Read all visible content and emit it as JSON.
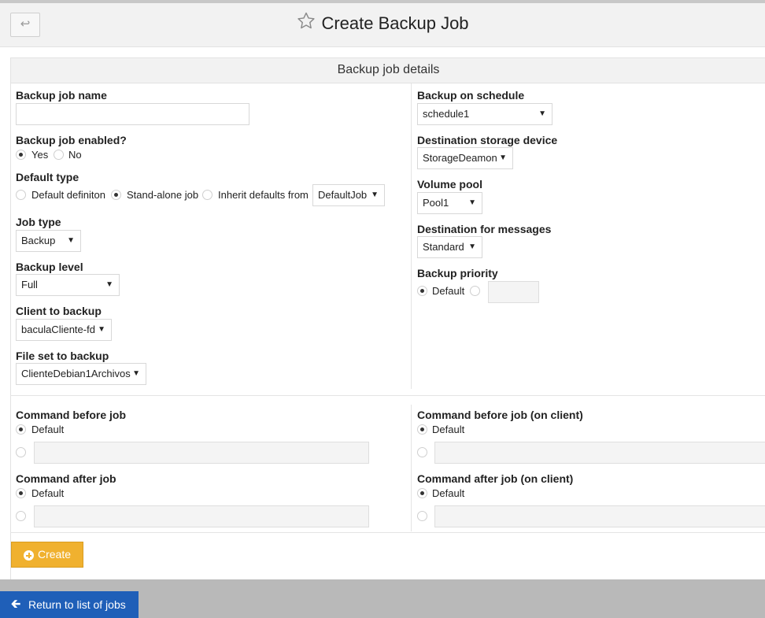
{
  "header": {
    "back_icon": "↩",
    "title": "Create Backup Job"
  },
  "panel": {
    "heading": "Backup job details"
  },
  "left": {
    "job_name": {
      "label": "Backup job name",
      "value": ""
    },
    "enabled": {
      "label": "Backup job enabled?",
      "yes": "Yes",
      "no": "No",
      "selected": "Yes"
    },
    "default_type": {
      "label": "Default type",
      "opt_definition": "Default definiton",
      "opt_standalone": "Stand-alone job",
      "opt_inherit": "Inherit defaults from",
      "inherit_value": "DefaultJob",
      "selected": "Stand-alone job"
    },
    "job_type": {
      "label": "Job type",
      "value": "Backup"
    },
    "backup_level": {
      "label": "Backup level",
      "value": "Full"
    },
    "client": {
      "label": "Client to backup",
      "value": "baculaCliente-fd"
    },
    "fileset": {
      "label": "File set to backup",
      "value": "ClienteDebian1Archivos"
    }
  },
  "right": {
    "schedule": {
      "label": "Backup on schedule",
      "value": "schedule1"
    },
    "storage": {
      "label": "Destination storage device",
      "value": "StorageDeamon"
    },
    "pool": {
      "label": "Volume pool",
      "value": "Pool1"
    },
    "messages": {
      "label": "Destination for messages",
      "value": "Standard"
    },
    "priority": {
      "label": "Backup priority",
      "default": "Default",
      "value": ""
    }
  },
  "commands": {
    "before": {
      "label": "Command before job",
      "default": "Default",
      "value": ""
    },
    "after": {
      "label": "Command after job",
      "default": "Default",
      "value": ""
    },
    "before_client": {
      "label": "Command before job (on client)",
      "default": "Default",
      "value": ""
    },
    "after_client": {
      "label": "Command after job (on client)",
      "default": "Default",
      "value": ""
    }
  },
  "actions": {
    "create": "Create",
    "return": "Return to list of jobs"
  },
  "colors": {
    "create_button": "#f0b12f",
    "return_button": "#1f5fb8",
    "footer": "#b9b9b9"
  }
}
